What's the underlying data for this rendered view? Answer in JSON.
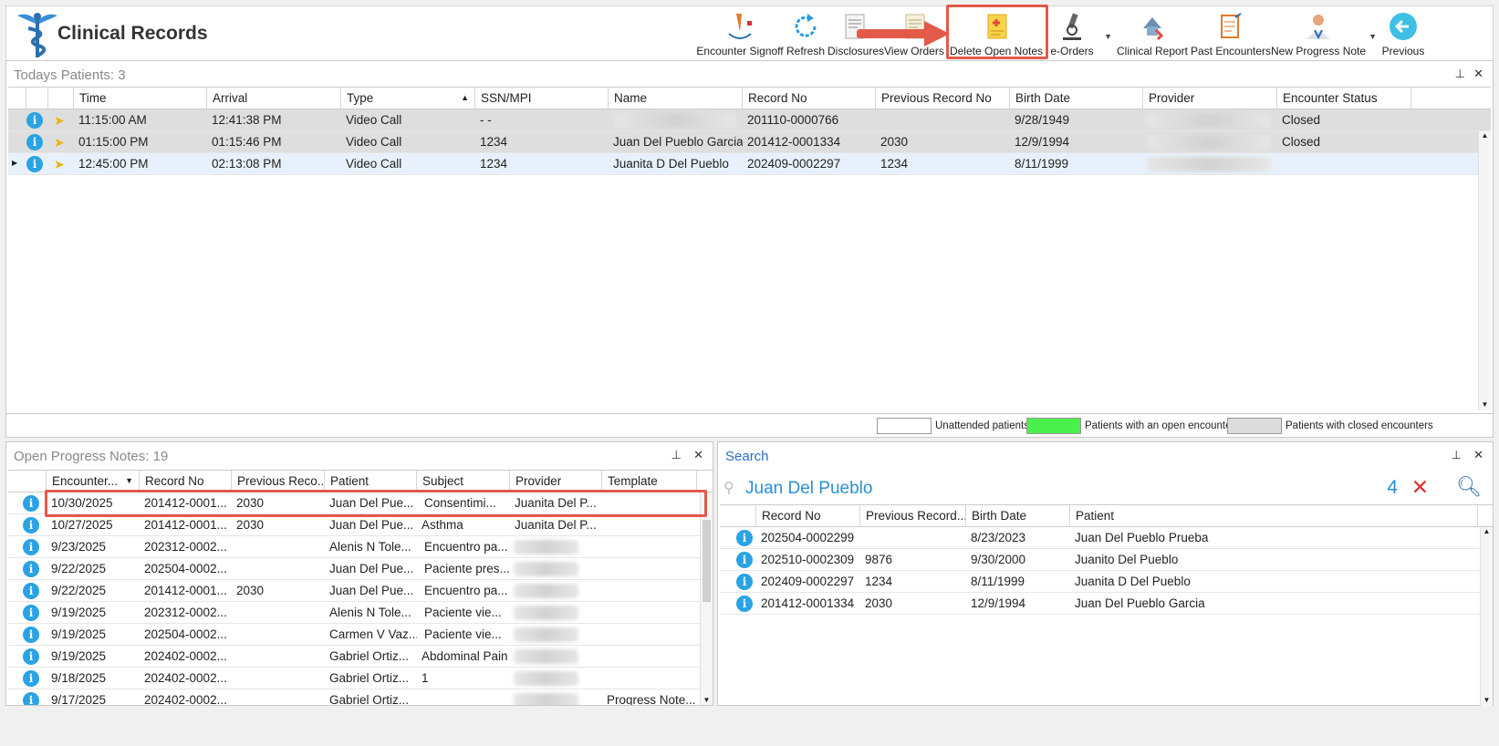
{
  "app": {
    "title": "Clinical Records"
  },
  "toolbar": {
    "items": [
      {
        "label": "Encounter Signoff",
        "icon": "signoff-icon"
      },
      {
        "label": "Refresh",
        "icon": "refresh-icon"
      },
      {
        "label": "Disclosures",
        "icon": "disclosures-icon"
      },
      {
        "label": "View Orders",
        "icon": "orders-icon"
      },
      {
        "label": "Delete Open Notes",
        "icon": "delete-notes-icon"
      },
      {
        "label": "e-Orders",
        "icon": "microscope-icon"
      },
      {
        "label": "Clinical Report",
        "icon": "clinical-report-icon"
      },
      {
        "label": "Past Encounters",
        "icon": "past-encounters-icon"
      },
      {
        "label": "New Progress Note",
        "icon": "doctor-icon"
      },
      {
        "label": "Previous",
        "icon": "back-arrow-icon"
      }
    ],
    "highlight_color": "#e35a4b"
  },
  "todays_patients": {
    "title_label": "Todays Patients:",
    "count": "3",
    "columns": [
      "Time",
      "Arrival",
      "Type",
      "SSN/MPI",
      "Name",
      "Record No",
      "Previous Record No",
      "Birth Date",
      "Provider",
      "Encounter Status"
    ],
    "rows": [
      {
        "time": "11:15:00 AM",
        "arrival": "12:41:38 PM",
        "type": "Video Call",
        "ssn": "- -",
        "name": "",
        "record": "201110-0000766",
        "prev": "",
        "birth": "9/28/1949",
        "provider": "",
        "status": "Closed"
      },
      {
        "time": "01:15:00 PM",
        "arrival": "01:15:46 PM",
        "type": "Video Call",
        "ssn": "1234",
        "name": "Juan Del Pueblo Garcia",
        "record": "201412-0001334",
        "prev": "2030",
        "birth": "12/9/1994",
        "provider": "",
        "status": "Closed"
      },
      {
        "time": "12:45:00 PM",
        "arrival": "02:13:08 PM",
        "type": "Video Call",
        "ssn": "1234",
        "name": "Juanita D Del Pueblo",
        "record": "202409-0002297",
        "prev": "1234",
        "birth": "8/11/1999",
        "provider": "",
        "status": ""
      }
    ],
    "legend": [
      {
        "label": "Unattended patients",
        "color": "#ffffff"
      },
      {
        "label": "Patients with an open encounter",
        "color": "#4cf04c"
      },
      {
        "label": "Patients with closed encounters",
        "color": "#dcdcdc"
      }
    ]
  },
  "open_notes": {
    "title_label": "Open Progress Notes:",
    "count": "19",
    "columns": [
      "Encounter...",
      "Record No",
      "Previous Reco...",
      "Patient",
      "Subject",
      "Provider",
      "Template"
    ],
    "rows": [
      {
        "date": "10/30/2025",
        "record": "201412-0001...",
        "prev": "2030",
        "patient": "Juan Del Pue...",
        "subject": "Consentimi...",
        "provider": "Juanita Del P...",
        "template": ""
      },
      {
        "date": "10/27/2025",
        "record": "201412-0001...",
        "prev": "2030",
        "patient": "Juan Del Pue...",
        "subject": "Asthma",
        "provider": "Juanita Del P...",
        "template": ""
      },
      {
        "date": "9/23/2025",
        "record": "202312-0002...",
        "prev": "",
        "patient": "Alenis N Tole...",
        "subject": "Encuentro pa...",
        "provider": "",
        "template": ""
      },
      {
        "date": "9/22/2025",
        "record": "202504-0002...",
        "prev": "",
        "patient": "Juan Del Pue...",
        "subject": "Paciente pres...",
        "provider": "",
        "template": ""
      },
      {
        "date": "9/22/2025",
        "record": "201412-0001...",
        "prev": "2030",
        "patient": "Juan Del Pue...",
        "subject": "Encuentro pa...",
        "provider": "",
        "template": ""
      },
      {
        "date": "9/19/2025",
        "record": "202312-0002...",
        "prev": "",
        "patient": "Alenis N Tole...",
        "subject": "Paciente vie...",
        "provider": "",
        "template": ""
      },
      {
        "date": "9/19/2025",
        "record": "202504-0002...",
        "prev": "",
        "patient": "Carmen V Vaz...",
        "subject": "Paciente vie...",
        "provider": "",
        "template": ""
      },
      {
        "date": "9/19/2025",
        "record": "202402-0002...",
        "prev": "",
        "patient": "Gabriel Ortiz...",
        "subject": "Abdominal Pain",
        "provider": "",
        "template": ""
      },
      {
        "date": "9/18/2025",
        "record": "202402-0002...",
        "prev": "",
        "patient": "Gabriel Ortiz...",
        "subject": "1",
        "provider": "",
        "template": ""
      },
      {
        "date": "9/17/2025",
        "record": "202402-0002...",
        "prev": "",
        "patient": "Gabriel Ortiz...",
        "subject": "",
        "provider": "",
        "template": "Progress Note..."
      }
    ]
  },
  "search": {
    "title": "Search",
    "query": "Juan Del Pueblo",
    "result_count": "4",
    "columns": [
      "Record No",
      "Previous Record...",
      "Birth Date",
      "Patient"
    ],
    "rows": [
      {
        "record": "202504-0002299",
        "prev": "",
        "birth": "8/23/2023",
        "patient": "Juan Del Pueblo Prueba"
      },
      {
        "record": "202510-0002309",
        "prev": "9876",
        "birth": "9/30/2000",
        "patient": "Juanito Del Pueblo"
      },
      {
        "record": "202409-0002297",
        "prev": "1234",
        "birth": "8/11/1999",
        "patient": "Juanita D Del Pueblo"
      },
      {
        "record": "201412-0001334",
        "prev": "2030",
        "birth": "12/9/1994",
        "patient": "Juan Del Pueblo Garcia"
      }
    ]
  }
}
